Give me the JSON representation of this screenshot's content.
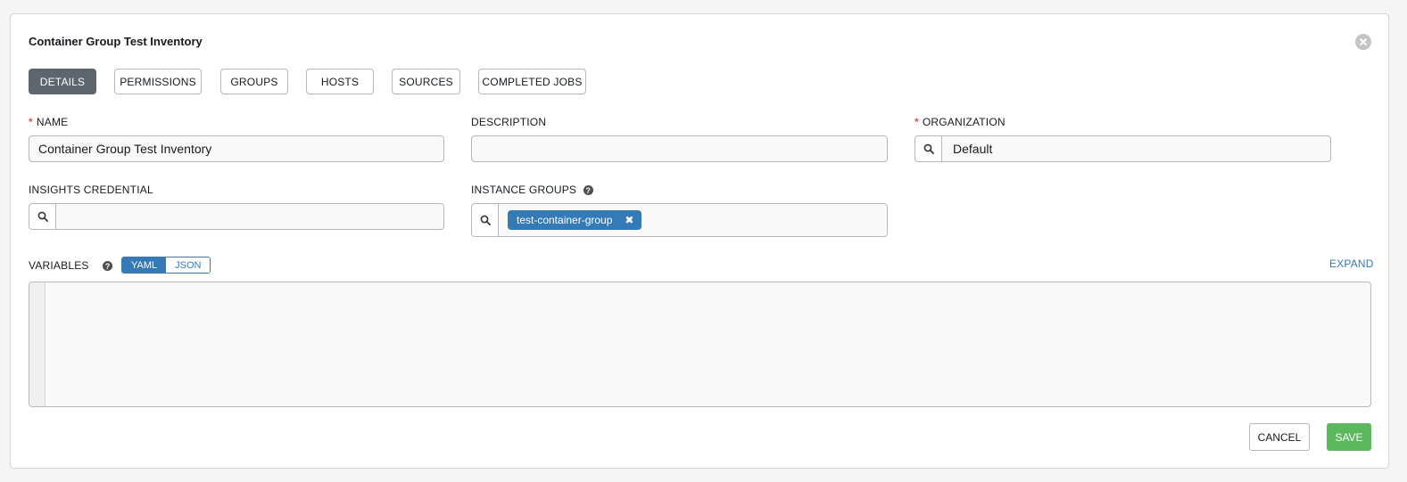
{
  "form": {
    "title": "Container Group Test Inventory",
    "close_icon": "close-circle-icon"
  },
  "tabs": [
    {
      "label": "DETAILS",
      "active": true
    },
    {
      "label": "PERMISSIONS"
    },
    {
      "label": "GROUPS"
    },
    {
      "label": "HOSTS"
    },
    {
      "label": "SOURCES"
    },
    {
      "label": "COMPLETED JOBS"
    }
  ],
  "fields": {
    "name": {
      "label": "NAME",
      "required": "*",
      "value": "Container Group Test Inventory"
    },
    "description": {
      "label": "DESCRIPTION",
      "value": ""
    },
    "organization": {
      "label": "ORGANIZATION",
      "required": "*",
      "value": "Default"
    },
    "insights_credential": {
      "label": "INSIGHTS CREDENTIAL",
      "value": ""
    },
    "instance_groups": {
      "label": "INSTANCE GROUPS",
      "help": "?",
      "chips": [
        {
          "label": "test-container-group",
          "remove": "✖"
        }
      ]
    },
    "variables": {
      "label": "VARIABLES",
      "help": "?",
      "mode_yaml": "YAML",
      "mode_json": "JSON",
      "selected_mode": "YAML",
      "expand": "EXPAND",
      "value": ""
    }
  },
  "actions": {
    "cancel": "CANCEL",
    "save": "SAVE"
  },
  "colors": {
    "primary": "#337ab7",
    "success": "#5cb85c",
    "active_tab": "#5e656c",
    "required": "#d9534f"
  }
}
